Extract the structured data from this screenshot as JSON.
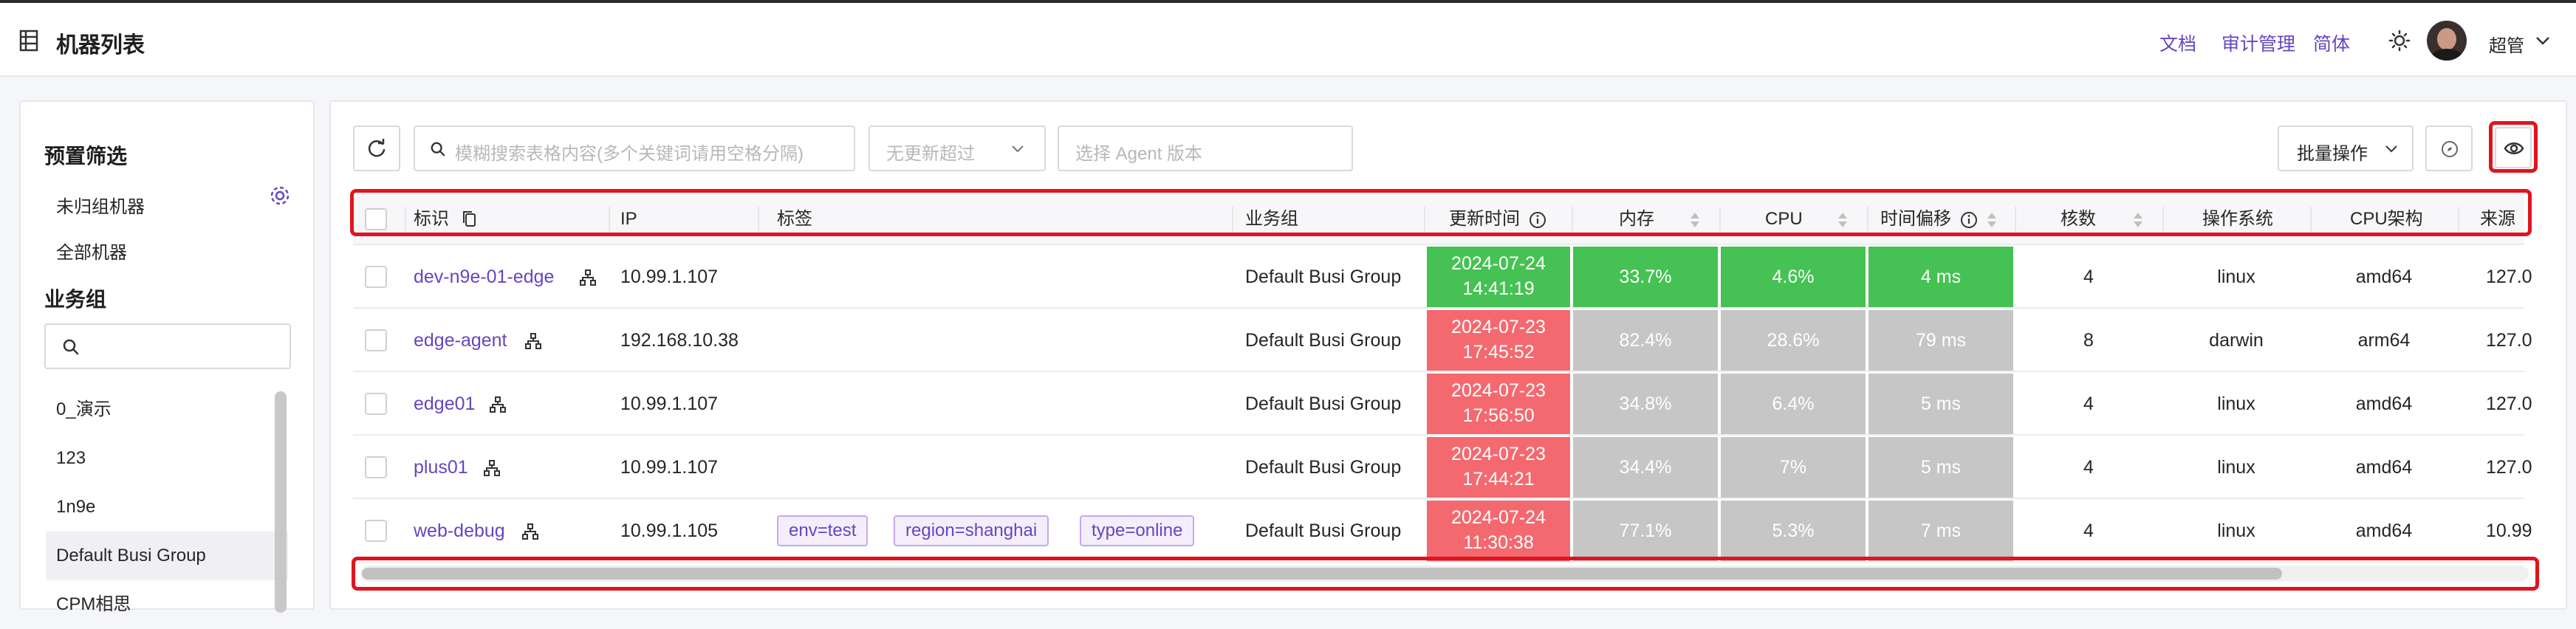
{
  "header": {
    "title": "机器列表",
    "links": {
      "docs": "文档",
      "audit": "审计管理",
      "lang": "简体"
    },
    "user": "超管"
  },
  "sidebar": {
    "preset_title": "预置筛选",
    "preset_items": [
      "未归组机器",
      "全部机器"
    ],
    "group_title": "业务组",
    "search_placeholder": "",
    "groups": [
      "0_演示",
      "123",
      "1n9e",
      "Default Busi Group",
      "CPM相思"
    ]
  },
  "toolbar": {
    "search_placeholder": "模糊搜索表格内容(多个关键词请用空格分隔)",
    "no_update_placeholder": "无更新超过",
    "agent_version_placeholder": "选择 Agent 版本",
    "batch_label": "批量操作"
  },
  "table": {
    "columns": {
      "ident": "标识",
      "ip": "IP",
      "tags": "标签",
      "group": "业务组",
      "update_time": "更新时间",
      "mem": "内存",
      "cpu": "CPU",
      "offset": "时间偏移",
      "cores": "核数",
      "os": "操作系统",
      "arch": "CPU架构",
      "source": "来源"
    },
    "rows": [
      {
        "ident": "dev-n9e-01-edge",
        "ip": "10.99.1.107",
        "tags": [],
        "group": "Default Busi Group",
        "date": "2024-07-24",
        "time": "14:41:19",
        "mem": "33.7%",
        "cpu": "4.6%",
        "offset": "4 ms",
        "cores": "4",
        "os": "linux",
        "arch": "amd64",
        "source": "127.0"
      },
      {
        "ident": "edge-agent",
        "ip": "192.168.10.38",
        "tags": [],
        "group": "Default Busi Group",
        "date": "2024-07-23",
        "time": "17:45:52",
        "mem": "82.4%",
        "cpu": "28.6%",
        "offset": "79 ms",
        "cores": "8",
        "os": "darwin",
        "arch": "arm64",
        "source": "127.0"
      },
      {
        "ident": "edge01",
        "ip": "10.99.1.107",
        "tags": [],
        "group": "Default Busi Group",
        "date": "2024-07-23",
        "time": "17:56:50",
        "mem": "34.8%",
        "cpu": "6.4%",
        "offset": "5 ms",
        "cores": "4",
        "os": "linux",
        "arch": "amd64",
        "source": "127.0"
      },
      {
        "ident": "plus01",
        "ip": "10.99.1.107",
        "tags": [],
        "group": "Default Busi Group",
        "date": "2024-07-23",
        "time": "17:44:21",
        "mem": "34.4%",
        "cpu": "7%",
        "offset": "5 ms",
        "cores": "4",
        "os": "linux",
        "arch": "amd64",
        "source": "127.0"
      },
      {
        "ident": "web-debug",
        "ip": "10.99.1.105",
        "tags": [
          "env=test",
          "region=shanghai",
          "type=online"
        ],
        "group": "Default Busi Group",
        "date": "2024-07-24",
        "time": "11:30:38",
        "mem": "77.1%",
        "cpu": "5.3%",
        "offset": "7 ms",
        "cores": "4",
        "os": "linux",
        "arch": "amd64",
        "source": "10.99"
      }
    ]
  },
  "colors": {
    "accent": "#6546c1",
    "status_ok": "#45c253",
    "status_stale": "#f4696f",
    "metric_gray": "#c6c6c6",
    "highlight_red": "#e0141e"
  }
}
